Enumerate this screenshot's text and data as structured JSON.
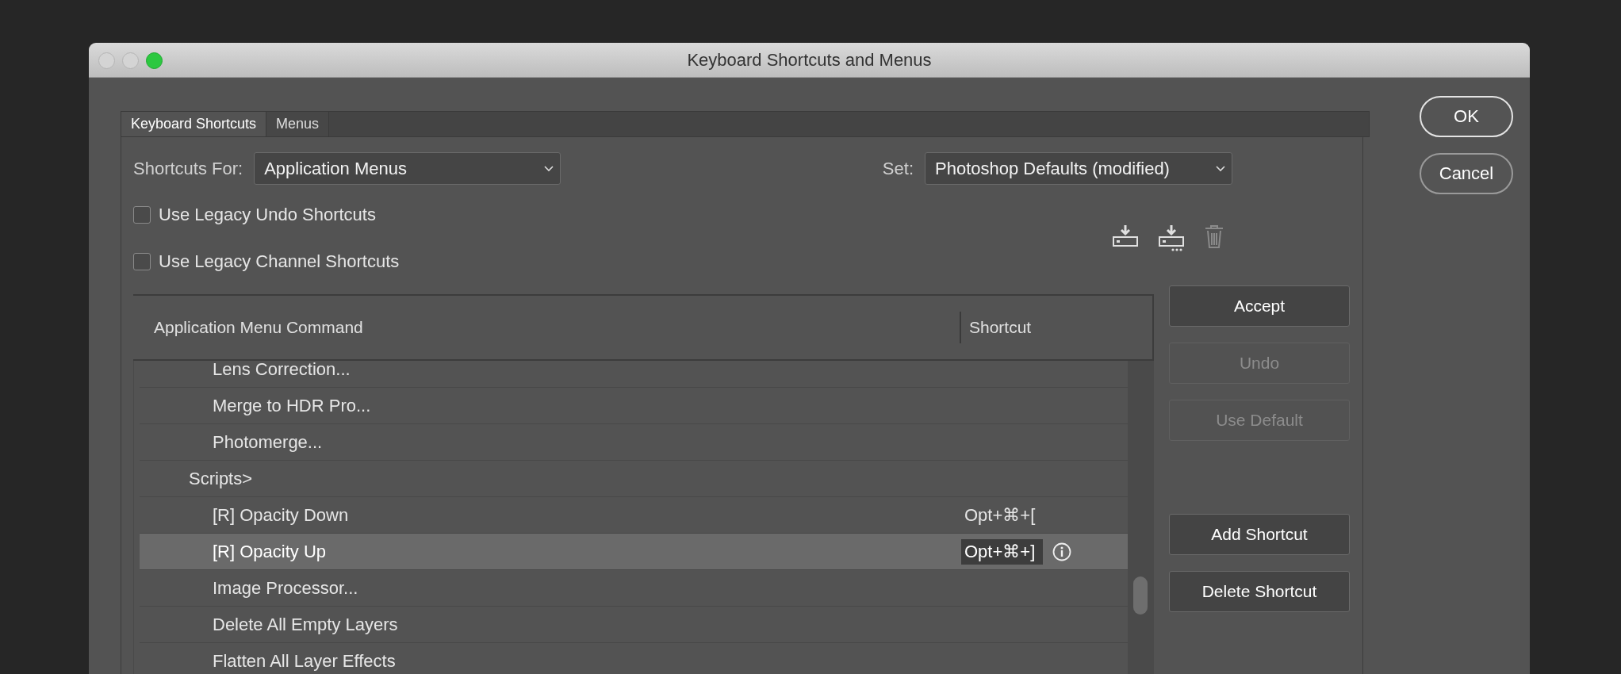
{
  "window": {
    "title": "Keyboard Shortcuts and Menus"
  },
  "tabs": [
    {
      "label": "Keyboard Shortcuts",
      "selected": true
    },
    {
      "label": "Menus",
      "selected": false
    }
  ],
  "shortcuts_for": {
    "label": "Shortcuts For:",
    "value": "Application Menus"
  },
  "set": {
    "label": "Set:",
    "value": "Photoshop Defaults (modified)"
  },
  "options": [
    {
      "label": "Use Legacy Undo Shortcuts",
      "checked": false
    },
    {
      "label": "Use Legacy Channel Shortcuts",
      "checked": false
    }
  ],
  "set_actions": [
    {
      "kind": "save",
      "disabled": false
    },
    {
      "kind": "save_as",
      "disabled": false
    },
    {
      "kind": "delete",
      "disabled": true
    }
  ],
  "table": {
    "columns": [
      "Application Menu Command",
      "Shortcut"
    ],
    "rows": [
      {
        "children": [
          {
            "label": "Lens Correction...",
            "selected": false
          },
          {
            "label": "Merge to HDR Pro...",
            "selected": false
          },
          {
            "label": "Photomerge...",
            "selected": false
          }
        ]
      },
      {
        "label": "Scripts>",
        "selected": false,
        "children": [
          {
            "label": "[R] Opacity Down",
            "shortcut": "Opt+⌘+[",
            "selected": false
          },
          {
            "label": "[R] Opacity Up",
            "shortcut": "Opt+⌘+]",
            "selected": true
          },
          {
            "label": "Image Processor...",
            "selected": false
          },
          {
            "label": "Delete All Empty Layers",
            "selected": false
          },
          {
            "label": "Flatten All Layer Effects",
            "selected": false
          }
        ]
      }
    ]
  },
  "actions": [
    {
      "label": "Accept",
      "disabled": false
    },
    {
      "label": "Undo",
      "disabled": true
    },
    {
      "label": "Use Default",
      "disabled": true
    },
    {
      "label": "Add Shortcut",
      "disabled": false
    },
    {
      "label": "Delete Shortcut",
      "disabled": false
    }
  ],
  "dialog_buttons": [
    {
      "label": "OK",
      "default": true
    },
    {
      "label": "Cancel",
      "default": false
    }
  ]
}
